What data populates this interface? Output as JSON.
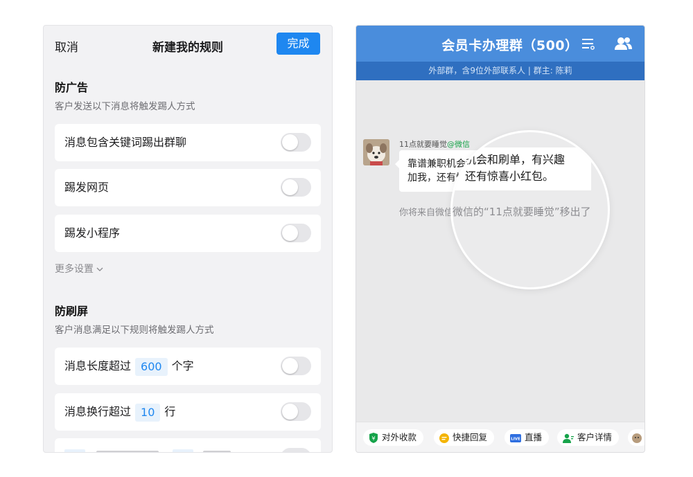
{
  "left": {
    "header": {
      "cancel": "取消",
      "title": "新建我的规则",
      "done": "完成"
    },
    "ad_section": {
      "title": "防广告",
      "subtitle": "客户发送以下消息将触发踢人方式",
      "rows": [
        "消息包含关键词踢出群聊",
        "踢发网页",
        "踢发小程序"
      ]
    },
    "more_settings": "更多设置",
    "spam_section": {
      "title": "防刷屏",
      "subtitle": "客户消息满足以下规则将触发踢人方式",
      "length_prefix": "消息长度超过",
      "length_value": "600",
      "length_suffix": "个字",
      "lines_prefix": "消息换行超过",
      "lines_value": "10",
      "lines_suffix": "行"
    }
  },
  "right": {
    "header": {
      "title": "会员卡办理群（500）"
    },
    "subheader": "外部群，含9位外部联系人 | 群主: 陈莉",
    "message": {
      "sender": "11点就要睡觉",
      "sender_tag": "@微信",
      "line1": "靠谱兼职机会和刷单，有兴趣的",
      "line2": "加我，还有惊喜小红包。"
    },
    "system_message": "你将来自微信的“11点就要睡觉”移出了群聊",
    "lens": {
      "line1": "机会和刷单，有兴趣",
      "line2": "还有惊喜小红包。",
      "sys": "微信的“11点就要睡觉”移出了"
    },
    "toolbar": [
      "对外收款",
      "快捷回复",
      "直播",
      "客户详情"
    ],
    "colors": {
      "header": "#4a8ddc",
      "subheader": "#2f6fc0",
      "accent": "#1e87f0"
    }
  }
}
